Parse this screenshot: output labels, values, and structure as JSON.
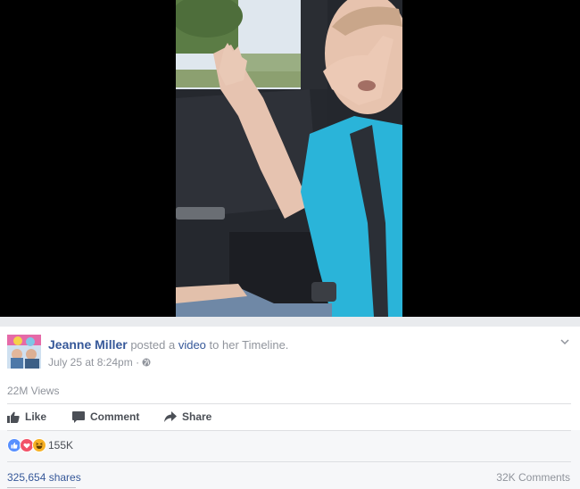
{
  "post": {
    "author": "Jeanne Miller",
    "action_text": "posted a",
    "object_link": "video",
    "target_text": "to her Timeline.",
    "timestamp": "July 25 at 8:24pm",
    "separator": "·",
    "views": "22M Views"
  },
  "actions": {
    "like": "Like",
    "comment": "Comment",
    "share": "Share"
  },
  "reactions": {
    "icons": [
      "like-icon",
      "love-icon",
      "haha-icon"
    ],
    "count": "155K"
  },
  "footer": {
    "shares": "325,654 shares",
    "comments": "32K Comments"
  },
  "colors": {
    "link": "#365899",
    "meta": "#90949c",
    "action": "#4b4f56",
    "like": "#5890ff",
    "love": "#f25268",
    "haha": "#f7b125"
  }
}
